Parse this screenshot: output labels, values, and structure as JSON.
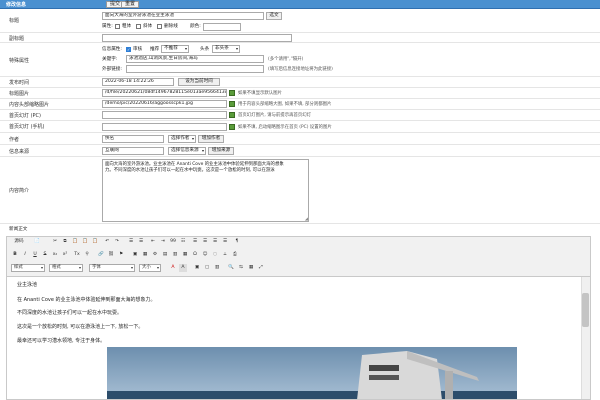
{
  "topbar": {
    "title": "修改信息",
    "submit": "提交",
    "reset": "重置"
  },
  "title_row": {
    "label": "标题",
    "value": "面向大海的室外游泳池在业主泳池",
    "btn": "选文"
  },
  "attr": {
    "label": "属性:",
    "opts": [
      "粗体",
      "斜体",
      "删除线"
    ],
    "color_label": "颜色:"
  },
  "subtitle": {
    "label": "副标题"
  },
  "special": {
    "label": "特殊属性",
    "info_label": "信息属性:",
    "audit": "审核",
    "recommend_label": "推荐",
    "recommend_value": "不推荐",
    "headline_label": "头条",
    "headline_value": "非头条",
    "keyword_label": "关键字:",
    "keyword_value": "泳池酒店,山洞风景,生日房间,海岛",
    "keyword_hint": "(多个请用\",\"隔开)",
    "outlink_label": "外部链接:",
    "outlink_hint": "(填写后信息连接地址将为此链接)"
  },
  "publish": {
    "label": "发布时间",
    "value": "2022-06-18 14:22:26",
    "btn": "设为当前时间"
  },
  "title_img": {
    "label": "标题图片",
    "value": "/d/file/20220621/08df14967828115e013ae9566413cab",
    "hint": "如果不填显示默认图片"
  },
  "content_img": {
    "label": "内容头部缩略图片",
    "value": "/demo/pic/20220616/aggoosscpk1.jpg",
    "hint": "用于内容头部缩略大图, 如果不填, 部分则都图片"
  },
  "home_pc": {
    "label": "首页幻灯 (PC)",
    "hint": "首页幻灯图片, 请与前提示再首页幻灯"
  },
  "home_mobile": {
    "label": "首页幻灯 (手机)",
    "hint": "如果不填, 启动缩略图示在首页 (PC) 设置的图片"
  },
  "author": {
    "label": "作者",
    "value": "佚名",
    "sel": "选择作者",
    "btn": "增加作者"
  },
  "source": {
    "label": "信息来源",
    "value": "互联网",
    "sel": "选择信息来源",
    "btn": "增加来源"
  },
  "summary": {
    "label": "内容简介",
    "lines": [
      "面向大海的室外游泳池。业主泳池在 Ananti Cove 的业主泳池中体验延伸到那面大海的想象",
      "力。不同深度的水池让孩子们可以一起在水中玩耍。这次是一个放松的时刻, 可以在游泳"
    ]
  },
  "body_label": "新闻正文",
  "toolbar": {
    "row1": [
      "源码",
      "📄",
      "✂",
      "⧉",
      "📋",
      "📋",
      "📋",
      "↶",
      "↷",
      "☰",
      "☰",
      "⇤",
      "⇥",
      "99",
      "☷",
      "☰",
      "☰",
      "☰",
      "☰",
      "¶"
    ],
    "row2": [
      "B",
      "I",
      "U",
      "S",
      "x₂",
      "x²",
      "Tx",
      "⚲",
      "🔗",
      "⛓",
      "⚑",
      "▣",
      "▦",
      "⚙",
      "▤",
      "▥",
      "▦",
      "Ω",
      "☺",
      "◌",
      "⟂",
      "⎙"
    ],
    "styles": "样式",
    "format": "格式",
    "font": "字体",
    "size": "大小",
    "row3": [
      "A",
      "A",
      "▣",
      "▢",
      "▥",
      "🔍",
      "⇆",
      "▦",
      "⤢"
    ]
  },
  "editor": {
    "paragraphs": [
      "业主泳池",
      "在 Ananti Cove 的业主泳池中体验延伸到那面大海的想象力。",
      "不同深度的水池让孩子们可以一起在水中玩耍。",
      "这次是一个放松的时刻, 可以在游泳池上一下, 放松一下。",
      "最幸还可以学习潜水领地, 专注于身体。"
    ]
  },
  "colors": {
    "topbar": "#4a90d0",
    "accent": "#2f7fd6"
  }
}
